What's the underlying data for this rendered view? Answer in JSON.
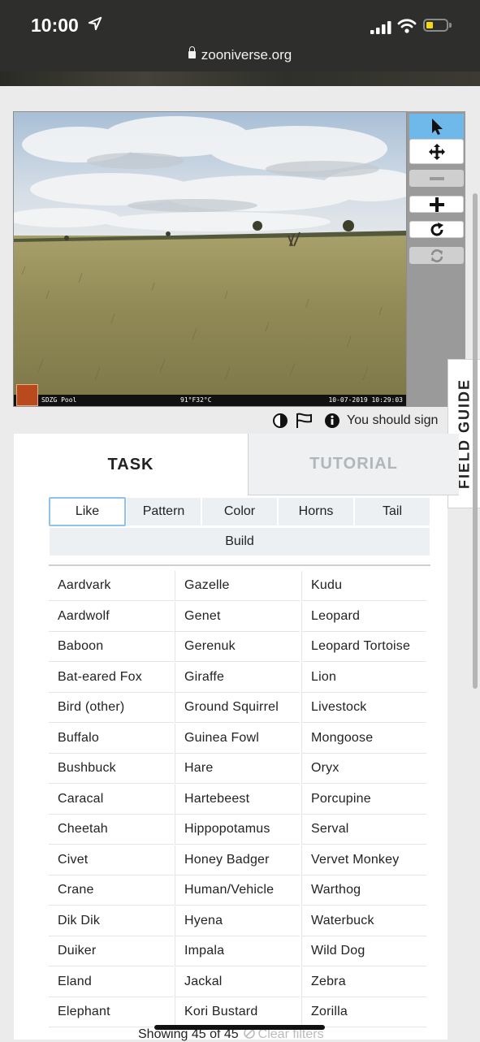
{
  "status_bar": {
    "time": "10:00",
    "url": "zooniverse.org"
  },
  "subject": {
    "footer_source": "SDZG Pool",
    "footer_temp": "91°F32°C",
    "footer_datetime": "10-07-2019 10:29:03",
    "logo_text": "Bushnell"
  },
  "toolbar": {
    "tools": [
      {
        "name": "pointer-icon",
        "state": "active"
      },
      {
        "name": "move-icon",
        "state": "normal"
      },
      {
        "name": "zoom-out-icon",
        "state": "disabled"
      },
      {
        "name": "zoom-in-icon",
        "state": "normal"
      },
      {
        "name": "rotate-icon",
        "state": "normal"
      },
      {
        "name": "reset-icon",
        "state": "disabled"
      }
    ]
  },
  "meta": {
    "sign_in_text": "You should sign"
  },
  "field_guide_label": "FIELD GUIDE",
  "tabs": {
    "task": "TASK",
    "tutorial": "TUTORIAL"
  },
  "filters": [
    "Like",
    "Pattern",
    "Color",
    "Horns",
    "Tail",
    "Build"
  ],
  "species_columns": [
    [
      "Aardvark",
      "Aardwolf",
      "Baboon",
      "Bat-eared Fox",
      "Bird (other)",
      "Buffalo",
      "Bushbuck",
      "Caracal",
      "Cheetah",
      "Civet",
      "Crane",
      "Dik Dik",
      "Duiker",
      "Eland",
      "Elephant"
    ],
    [
      "Gazelle",
      "Genet",
      "Gerenuk",
      "Giraffe",
      "Ground Squirrel",
      "Guinea Fowl",
      "Hare",
      "Hartebeest",
      "Hippopotamus",
      "Honey Badger",
      "Human/Vehicle",
      "Hyena",
      "Impala",
      "Jackal",
      "Kori Bustard"
    ],
    [
      "Kudu",
      "Leopard",
      "Leopard Tortoise",
      "Lion",
      "Livestock",
      "Mongoose",
      "Oryx",
      "Porcupine",
      "Serval",
      "Vervet Monkey",
      "Warthog",
      "Waterbuck",
      "Wild Dog",
      "Zebra",
      "Zorilla"
    ]
  ],
  "footer": {
    "showing": "Showing 45 of 45",
    "clear_filters": "Clear filters"
  },
  "colors": {
    "active_tool": "#6fb8ea",
    "selected_filter_border": "#8fc2ec",
    "tutorial_tab_text": "#b0b6ba"
  }
}
